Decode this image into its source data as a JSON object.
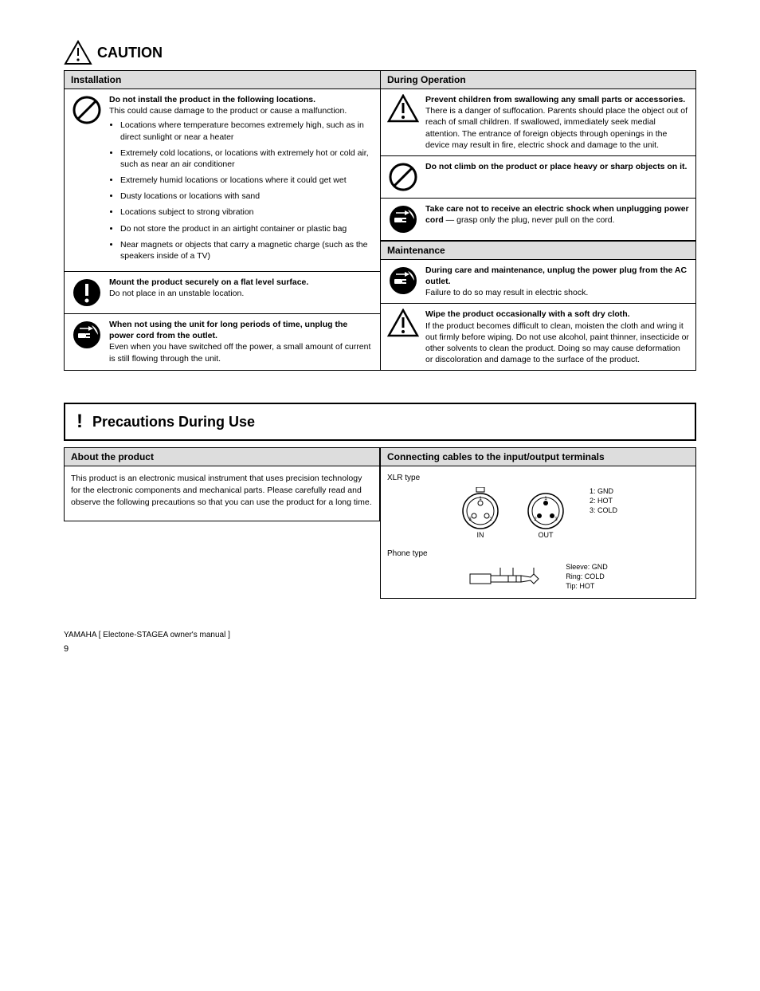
{
  "header": {
    "caution": "CAUTION"
  },
  "left": {
    "installation_head": "Installation",
    "inst_strong": "Do not install the product in the following locations.",
    "inst_text": "This could cause damage to the product or cause a malfunction.",
    "inst_items": [
      "Locations where temperature becomes extremely high, such as in direct sunlight or near a heater",
      "Extremely cold locations, or locations with extremely hot or cold air, such as near an air conditioner",
      "Extremely humid locations or locations where it could get wet",
      "Dusty locations or locations with sand",
      "Locations subject to strong vibration",
      "Do not store the product in an airtight container or plastic bag",
      "Near magnets or objects that carry a magnetic charge (such as the speakers inside of a TV)"
    ],
    "mount_strong": "Mount the product securely on a flat level surface.",
    "mount_text": "Do not place in an unstable location.",
    "unplug_strong": "When not using the unit for long periods of time, unplug the power cord from the outlet.",
    "unplug_text": "Even when you have switched off the power, a small amount of current is still flowing through the unit."
  },
  "right": {
    "operation_head": "During Operation",
    "children_strong": "Prevent children from swallowing any small parts or accessories.",
    "children_text": "There is a danger of suffocation. Parents should place the object out of reach of small children. If swallowed, immediately seek medial attention. The entrance of foreign objects through openings in the device may result in fire, electric shock and damage to the unit.",
    "climb_strong": "Do not climb on the product or place heavy or sharp objects on it.",
    "shock_strong": "Take care not to receive an electric shock when unplugging power cord",
    "shock_text": " — grasp only the plug, never pull on the cord.",
    "maintenance_head": "Maintenance",
    "maint_strong": "During care and maintenance, unplug the power plug from the AC outlet.",
    "maint_text": "Failure to do so may result in electric shock.",
    "wipe_strong": "Wipe the product occasionally with a soft dry cloth.",
    "wipe_text": "If the product becomes difficult to clean, moisten the cloth and wring it out firmly before wiping. Do not use alcohol, paint thinner, insecticide or other solvents to clean the product. Doing so may cause deformation or discoloration and damage to the surface of the product."
  },
  "precautions": {
    "title": "Precautions During Use",
    "prod_head": "About the product",
    "prod_text": "This product is an electronic musical instrument that uses precision technology for the electronic components and mechanical parts. Please carefully read and observe the following precautions so that you can use the product for a long time.",
    "conn_head": "Connecting cables to the input/output terminals",
    "xlr_type_label": "XLR type",
    "xlr_in": "1: GND\n2: HOT\n3: COLD",
    "phone_type_label": "Phone type",
    "phone_labels": "Sleeve: GND\nRing: COLD\nTip: HOT",
    "in_label": "IN",
    "out_label": "OUT"
  },
  "footer": {
    "brand": "YAMAHA [ Electone-STAGEA owner's manual ]",
    "page": "9"
  }
}
